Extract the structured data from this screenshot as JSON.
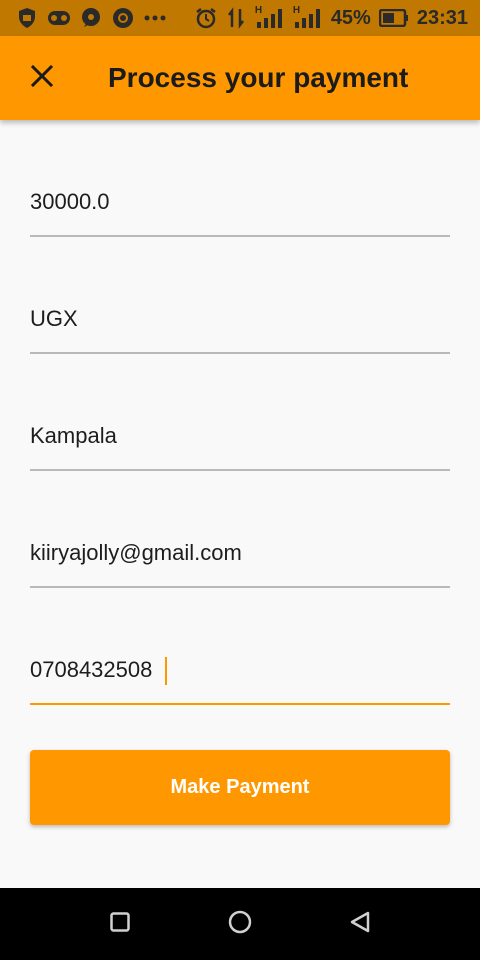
{
  "status_bar": {
    "battery_percent": "45%",
    "time": "23:31",
    "network_label_1": "H",
    "network_label_2": "H",
    "icons": [
      "shield-icon",
      "voicemail-icon",
      "messenger-icon",
      "chrome-icon",
      "more-dots-icon",
      "alarm-icon",
      "data-transfer-icon",
      "signal-icon",
      "signal-icon",
      "battery-icon"
    ]
  },
  "app_bar": {
    "title": "Process your payment",
    "close_icon": "close-icon"
  },
  "form": {
    "amount": "30000.0",
    "currency": "UGX",
    "city": "Kampala",
    "email": "kiiryajolly@gmail.com",
    "phone": "0708432508"
  },
  "button": {
    "label": "Make Payment"
  },
  "nav_bar": {
    "icons": [
      "recents-square-icon",
      "home-circle-icon",
      "back-triangle-icon"
    ]
  },
  "colors": {
    "accent": "#ff9800",
    "status_bar": "#c07800",
    "underline": "#b9b9b9"
  }
}
